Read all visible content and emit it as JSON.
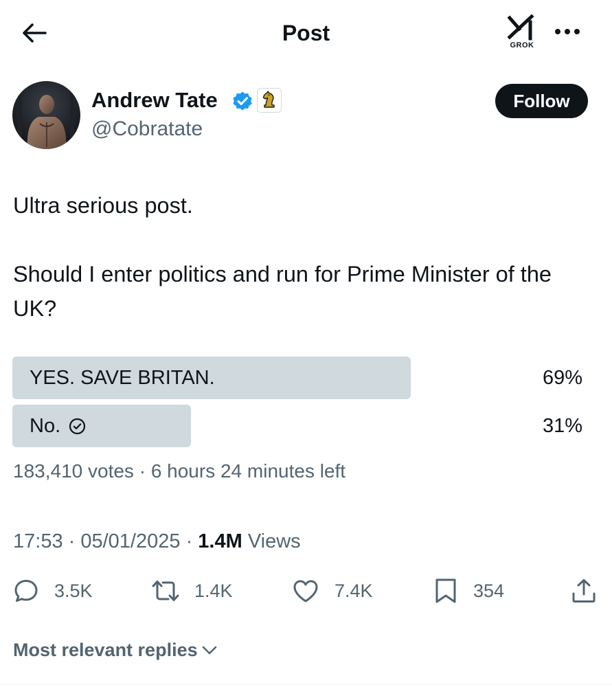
{
  "header": {
    "title": "Post",
    "grok_label": "GROK",
    "back_icon": "arrow-left-icon",
    "more_icon": "more-dots-icon"
  },
  "author": {
    "name": "Andrew Tate",
    "handle": "@Cobratate",
    "verified": true,
    "affiliate_badge_icon": "chess-knight-icon",
    "follow_label": "Follow"
  },
  "post": {
    "paragraphs": [
      "Ultra serious post.",
      "Should I enter politics and run for Prime Minister of the UK?"
    ]
  },
  "poll": {
    "options": [
      {
        "label": "YES. SAVE BRITAN.",
        "percent_text": "69%",
        "percent": 69,
        "selected": false
      },
      {
        "label": "No.",
        "percent_text": "31%",
        "percent": 31,
        "selected": true
      }
    ],
    "votes": "183,410 votes",
    "separator": " · ",
    "time_left": "6 hours 24 minutes left"
  },
  "meta": {
    "time": "17:53",
    "date": "05/01/2025",
    "separator": " · ",
    "views_count": "1.4M",
    "views_label": " Views"
  },
  "actions": {
    "replies": "3.5K",
    "reposts": "1.4K",
    "likes": "7.4K",
    "bookmarks": "354"
  },
  "replies_sort": {
    "label": "Most relevant replies"
  },
  "colors": {
    "text_primary": "#0f1419",
    "text_secondary": "#536471",
    "poll_bar": "#cfd9de",
    "verified_blue": "#1d9bf0",
    "follow_bg": "#0f1419"
  }
}
